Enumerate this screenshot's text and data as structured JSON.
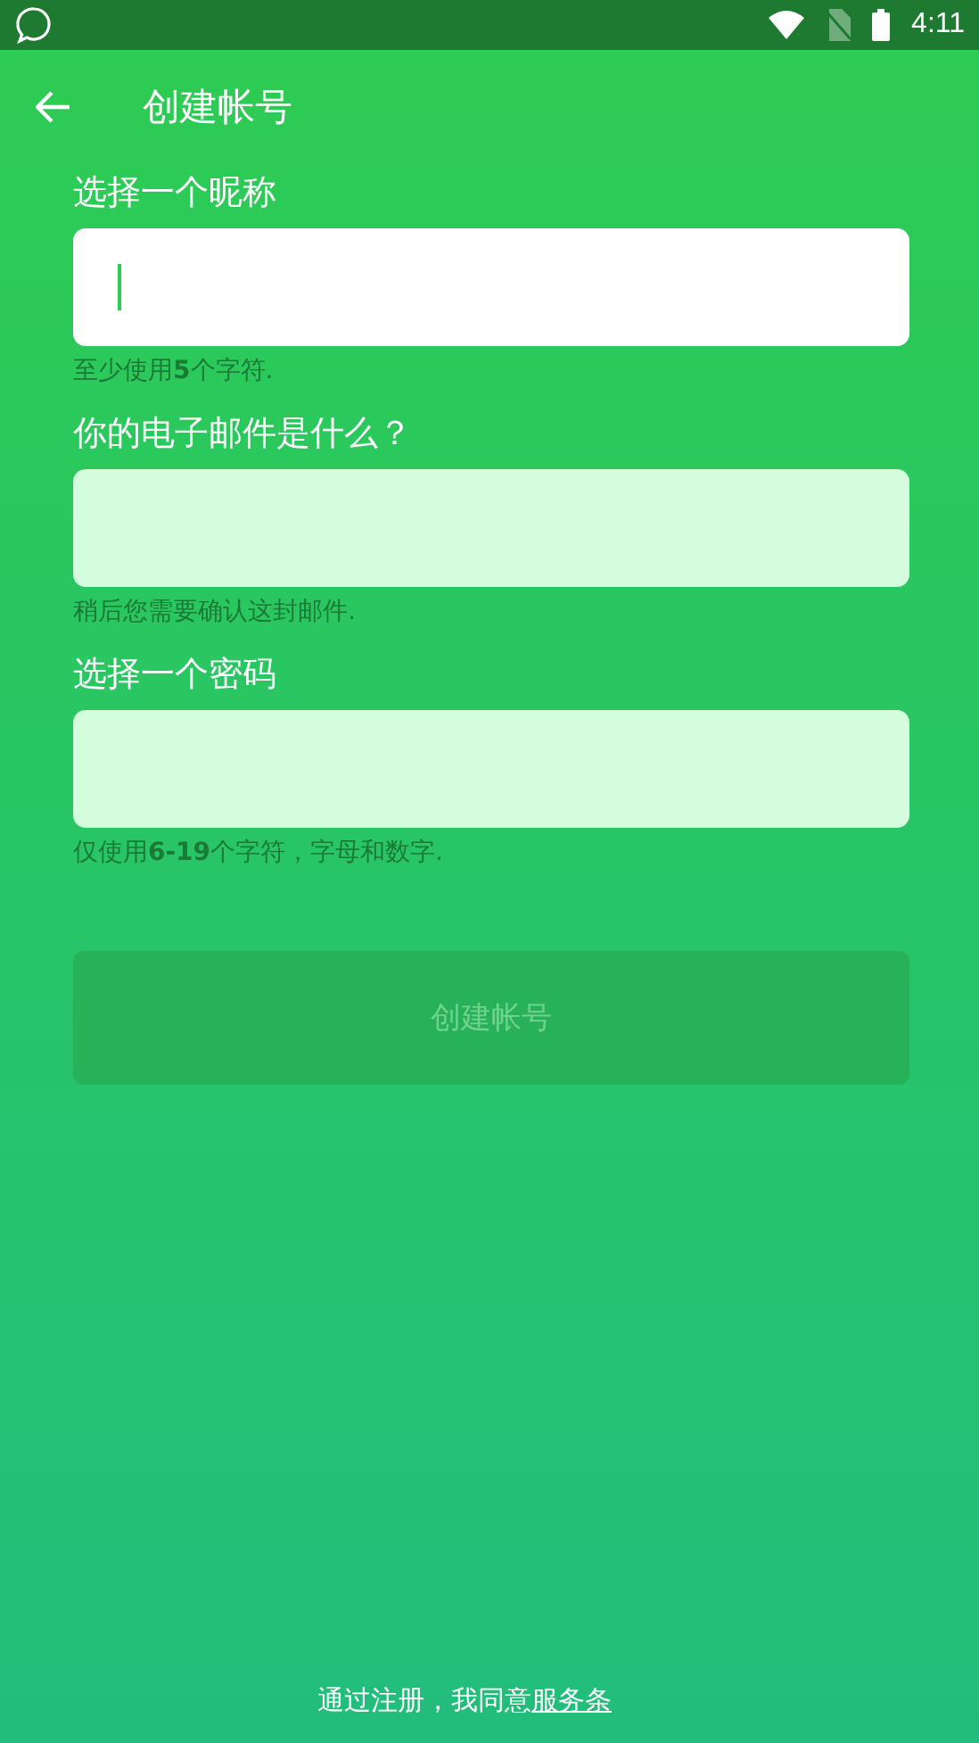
{
  "status_bar": {
    "time": "4:11"
  },
  "app_bar": {
    "title": "创建帐号"
  },
  "fields": [
    {
      "label": "选择一个昵称",
      "hint": "至少使用**5**个字符.",
      "focused": true
    },
    {
      "label": "你的电子邮件是什么？",
      "hint": "稍后您需要确认这封邮件.",
      "focused": false
    },
    {
      "label": "选择一个密码",
      "hint": "仅使用**6-19**个字符，字母和数字.",
      "focused": false
    }
  ],
  "submit": {
    "label": "创建帐号",
    "disabled": true
  },
  "footer": {
    "text": "通过注册，我同意",
    "link": "服务条"
  }
}
